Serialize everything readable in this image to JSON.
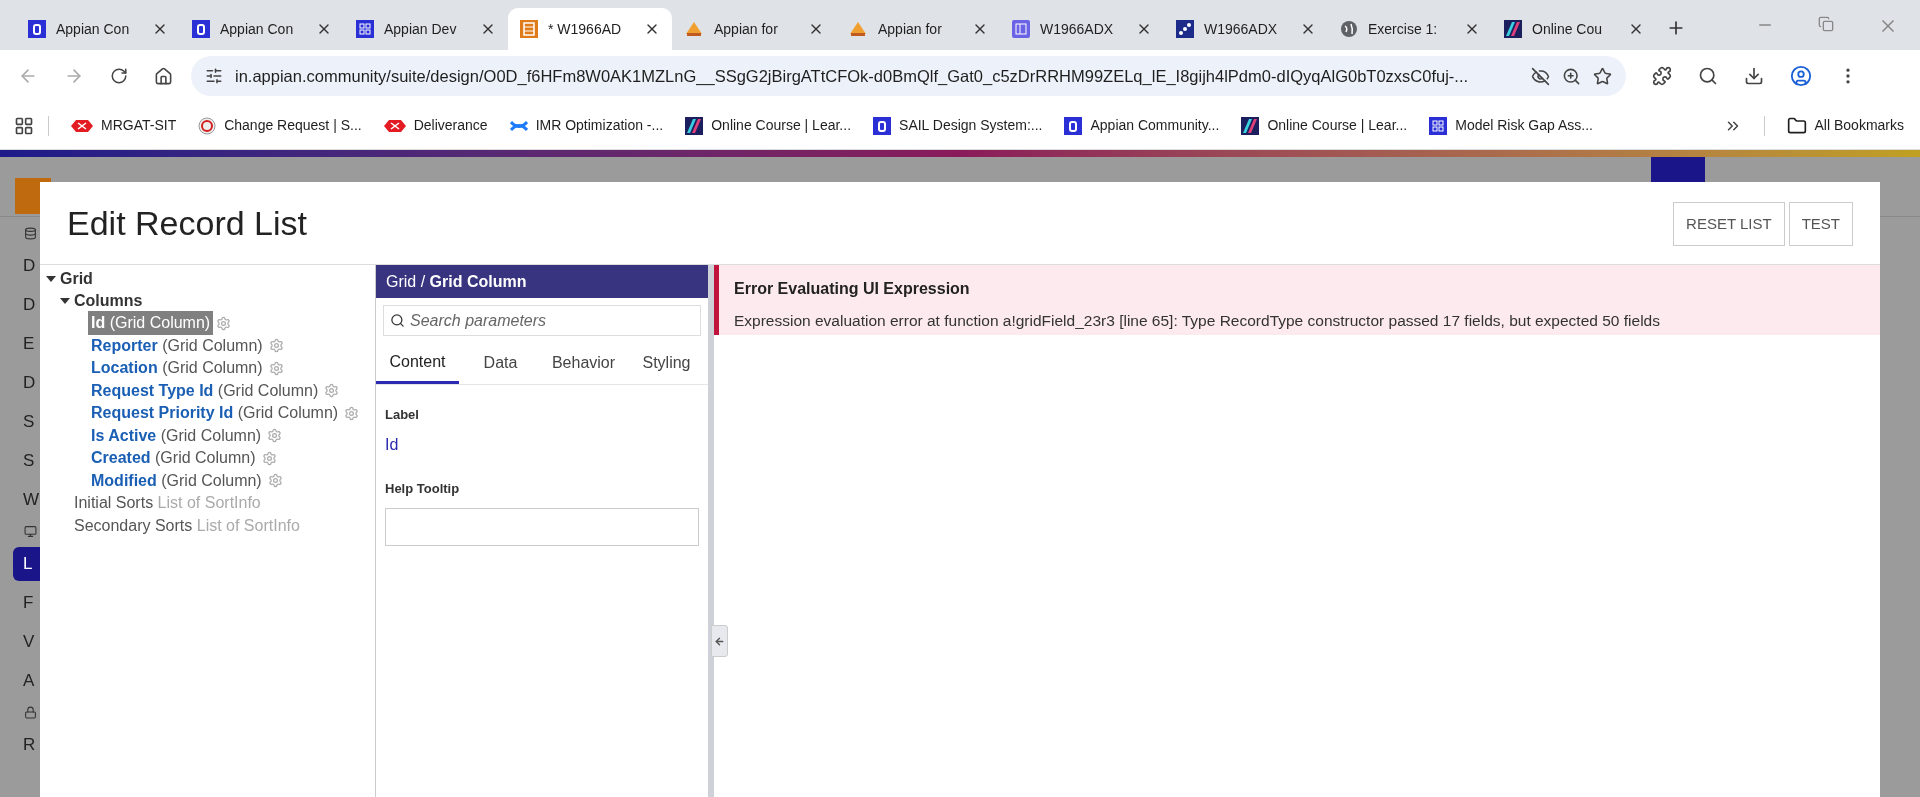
{
  "browser": {
    "tabs": [
      {
        "title": "Appian Con",
        "kind": "letter",
        "selected": false
      },
      {
        "title": "Appian Con",
        "kind": "letter",
        "selected": false
      },
      {
        "title": "Appian Dev",
        "kind": "grid",
        "selected": false
      },
      {
        "title": "* W1966AD",
        "kind": "list",
        "selected": true
      },
      {
        "title": "Appian for",
        "kind": "pma",
        "selected": false
      },
      {
        "title": "Appian for",
        "kind": "pma",
        "selected": false
      },
      {
        "title": "W1966ADX",
        "kind": "panel",
        "selected": false
      },
      {
        "title": "W1966ADX",
        "kind": "flow",
        "selected": false
      },
      {
        "title": "Exercise 1:",
        "kind": "globe",
        "selected": false
      },
      {
        "title": "Online Cou",
        "kind": "stripe",
        "selected": false
      }
    ],
    "url": "in.appian.community/suite/design/O0D_f6HFm8W0AK1MZLnG__SSgG2jBirgATtCFOk-d0BmQlf_Gat0_c5zDrRRHM99ZELq_lE_I8gijh4lPdm0-dIQyqAlG0bT0zxsC0fuj-...",
    "bookmarks": [
      {
        "title": "MRGAT-SIT",
        "kind": "hex"
      },
      {
        "title": "Change Request | S...",
        "kind": "target"
      },
      {
        "title": "Deliverance",
        "kind": "hex"
      },
      {
        "title": "IMR Optimization -...",
        "kind": "conf"
      },
      {
        "title": "Online Course | Lear...",
        "kind": "stripe"
      },
      {
        "title": "SAIL Design System:...",
        "kind": "letter"
      },
      {
        "title": "Appian Community...",
        "kind": "letter"
      },
      {
        "title": "Online Course | Lear...",
        "kind": "stripe"
      },
      {
        "title": "Model Risk Gap Ass...",
        "kind": "grid"
      }
    ],
    "all_bookmarks": "All Bookmarks"
  },
  "sidebar": {
    "items": [
      {
        "label": "D",
        "selected": false
      },
      {
        "label": "D",
        "selected": false
      },
      {
        "label": "E",
        "selected": false
      },
      {
        "label": "D",
        "selected": false
      },
      {
        "label": "S",
        "selected": false
      },
      {
        "label": "S",
        "selected": false
      },
      {
        "label": "W",
        "selected": false
      },
      {
        "label": "L",
        "selected": true
      },
      {
        "label": "F",
        "selected": false
      },
      {
        "label": "V",
        "selected": false
      },
      {
        "label": "A",
        "selected": false
      },
      {
        "label": "R",
        "selected": false
      }
    ]
  },
  "dialog": {
    "title": "Edit Record List",
    "buttons": [
      "RESET LIST",
      "TEST"
    ],
    "tree": [
      {
        "name": "Grid",
        "kind": "node",
        "expanded": true,
        "children": [
          {
            "name": "Columns",
            "kind": "node",
            "expanded": true,
            "children": [
              {
                "name": "Id",
                "type": "(Grid Column)",
                "kind": "column",
                "selected": true
              },
              {
                "name": "Reporter",
                "type": "(Grid Column)",
                "kind": "column",
                "selected": false
              },
              {
                "name": "Location",
                "type": "(Grid Column)",
                "kind": "column",
                "selected": false
              },
              {
                "name": "Request Type Id",
                "type": "(Grid Column)",
                "kind": "column",
                "selected": false
              },
              {
                "name": "Request Priority Id",
                "type": "(Grid Column)",
                "kind": "column",
                "selected": false
              },
              {
                "name": "Is Active",
                "type": "(Grid Column)",
                "kind": "column",
                "selected": false
              },
              {
                "name": "Created",
                "type": "(Grid Column)",
                "kind": "column",
                "selected": false
              },
              {
                "name": "Modified",
                "type": "(Grid Column)",
                "kind": "column",
                "selected": false
              }
            ]
          },
          {
            "name": "Initial Sorts",
            "type": "List of SortInfo",
            "kind": "param"
          },
          {
            "name": "Secondary Sorts",
            "type": "List of SortInfo",
            "kind": "param"
          }
        ]
      }
    ],
    "params": {
      "breadcrumb": "Grid / ",
      "current": "Grid Column",
      "search_placeholder": "Search parameters",
      "tabs": [
        {
          "label": "Content",
          "selected": true
        },
        {
          "label": "Data",
          "selected": false
        },
        {
          "label": "Behavior",
          "selected": false
        },
        {
          "label": "Styling",
          "selected": false
        }
      ],
      "fields": [
        {
          "label": "Label",
          "kind": "value",
          "value": "Id"
        },
        {
          "label": "Help Tooltip",
          "kind": "input"
        }
      ]
    },
    "error": {
      "title": "Error Evaluating UI Expression",
      "message": "Expression evaluation error at function a!gridField_23r3 [line 65]: Type RecordType constructor passed 17 fields, but expected 50 fields"
    }
  }
}
